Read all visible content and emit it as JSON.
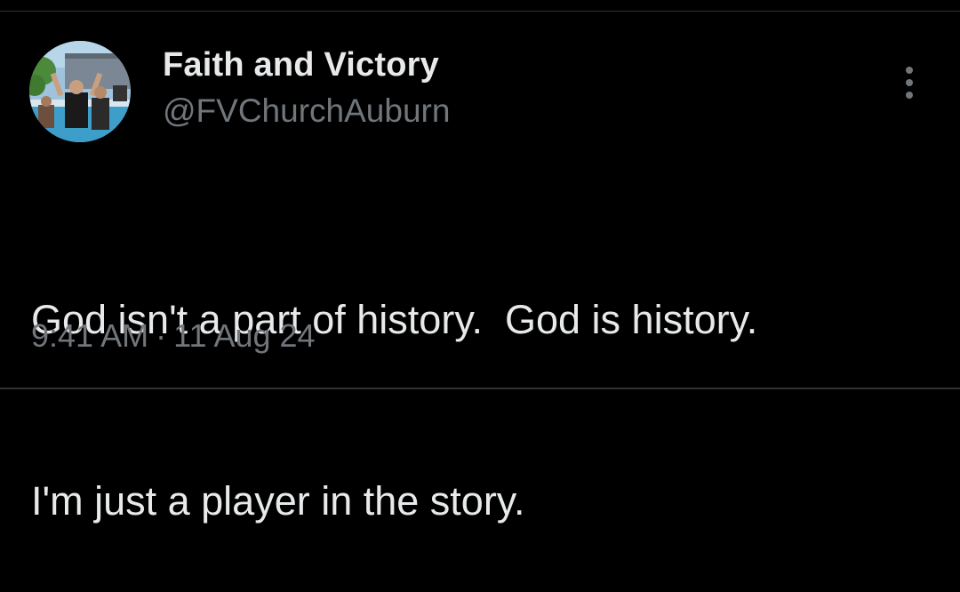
{
  "tweet": {
    "author": {
      "display_name": "Faith and Victory",
      "handle": "@FVChurchAuburn",
      "avatar_icon": "profile-photo"
    },
    "more_icon": "more-vertical-icon",
    "text_lines": [
      "God isn't a part of history.  God is history.",
      "I'm just a player in the story."
    ],
    "time": "9:41 AM",
    "separator": "·",
    "date": "11 Aug 24"
  },
  "colors": {
    "background": "#000000",
    "primary_text": "#e7e9ea",
    "secondary_text": "#71767b",
    "divider": "#2f3336"
  }
}
